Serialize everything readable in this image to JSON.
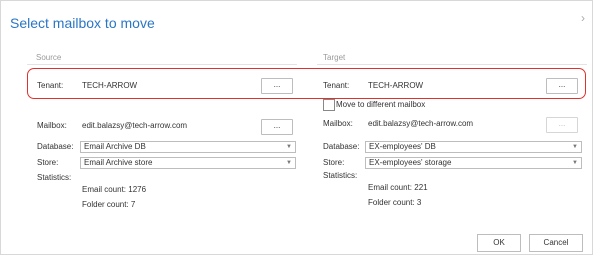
{
  "dialog": {
    "title": "Select mailbox to move",
    "nav_glyph": "›"
  },
  "source": {
    "heading": "Source",
    "tenant_label": "Tenant:",
    "tenant_value": "TECH-ARROW",
    "browse_label": "...",
    "mailbox_label": "Mailbox:",
    "mailbox_value": "edit.balazsy@tech-arrow.com",
    "database_label": "Database:",
    "database_value": "Email Archive DB",
    "store_label": "Store:",
    "store_value": "Email Archive store",
    "statistics_label": "Statistics:",
    "email_count": "Email count: 1276",
    "folder_count": "Folder count: 7"
  },
  "target": {
    "heading": "Target",
    "tenant_label": "Tenant:",
    "tenant_value": "TECH-ARROW",
    "browse_label": "...",
    "move_checkbox_label": "Move to different mailbox",
    "move_checked": false,
    "mailbox_label": "Mailbox:",
    "mailbox_value": "edit.balazsy@tech-arrow.com",
    "database_label": "Database:",
    "database_value": "EX-employees' DB",
    "store_label": "Store:",
    "store_value": "EX-employees' storage",
    "statistics_label": "Statistics:",
    "email_count": "Email count: 221",
    "folder_count": "Folder count: 3"
  },
  "footer": {
    "ok_label": "OK",
    "cancel_label": "Cancel"
  },
  "colors": {
    "title": "#2a76c6",
    "highlight_border": "#e0312f"
  }
}
